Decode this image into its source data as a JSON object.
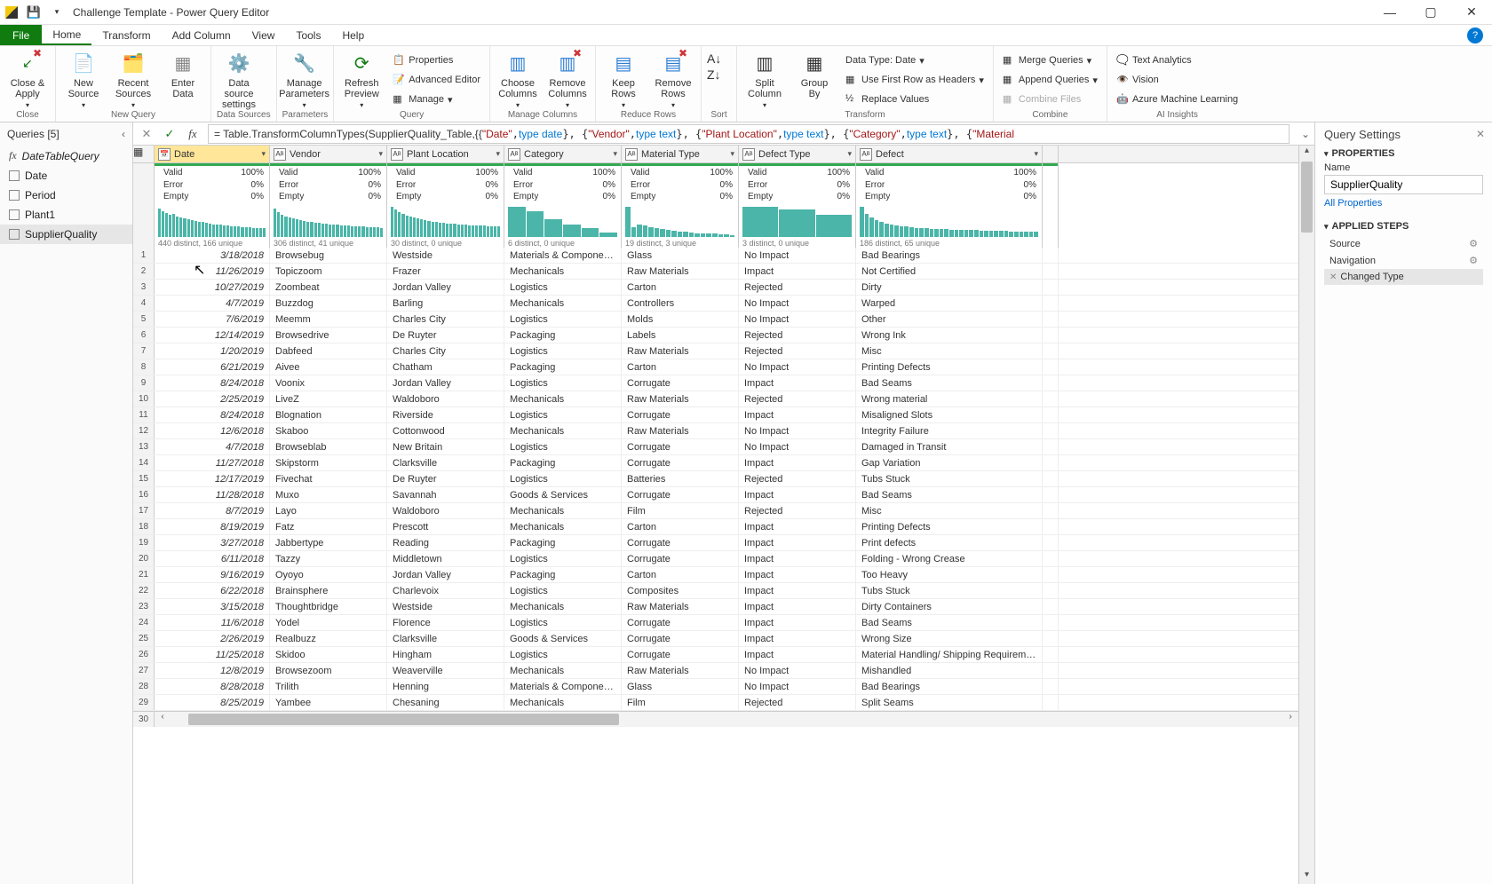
{
  "title": "Challenge Template - Power Query Editor",
  "menubar": {
    "file": "File",
    "tabs": [
      "Home",
      "Transform",
      "Add Column",
      "View",
      "Tools",
      "Help"
    ],
    "active": "Home"
  },
  "ribbon": {
    "close": {
      "label": "Close &\nApply",
      "group": "Close"
    },
    "new_query": {
      "new_source": "New\nSource",
      "recent": "Recent\nSources",
      "enter": "Enter\nData",
      "group": "New Query"
    },
    "data_sources": {
      "settings": "Data source\nsettings",
      "group": "Data Sources"
    },
    "parameters": {
      "manage": "Manage\nParameters",
      "group": "Parameters"
    },
    "query": {
      "refresh": "Refresh\nPreview",
      "properties": "Properties",
      "advanced": "Advanced Editor",
      "manage": "Manage",
      "group": "Query"
    },
    "manage_cols": {
      "choose": "Choose\nColumns",
      "remove": "Remove\nColumns",
      "group": "Manage Columns"
    },
    "reduce": {
      "keep": "Keep\nRows",
      "remove": "Remove\nRows",
      "group": "Reduce Rows"
    },
    "sort": {
      "group": "Sort"
    },
    "transform": {
      "split": "Split\nColumn",
      "group_by": "Group\nBy",
      "data_type": "Data Type: Date",
      "first_row": "Use First Row as Headers",
      "replace": "Replace Values",
      "group": "Transform"
    },
    "combine": {
      "merge": "Merge Queries",
      "append": "Append Queries",
      "combine_files": "Combine Files",
      "group": "Combine"
    },
    "ai": {
      "text": "Text Analytics",
      "vision": "Vision",
      "ml": "Azure Machine Learning",
      "group": "AI Insights"
    }
  },
  "queries_pane": {
    "title": "Queries [5]",
    "items": [
      {
        "name": "DateTableQuery",
        "type": "fx"
      },
      {
        "name": "Date",
        "type": "table"
      },
      {
        "name": "Period",
        "type": "table"
      },
      {
        "name": "Plant1",
        "type": "table"
      },
      {
        "name": "SupplierQuality",
        "type": "table",
        "selected": true
      }
    ]
  },
  "formula": {
    "prefix": "= Table.TransformColumnTypes(SupplierQuality_Table,{{",
    "seg_date_l": "\"Date\"",
    "seg_date_t": "type date",
    "seg_vendor_l": "\"Vendor\"",
    "seg_text": "type text",
    "seg_plant_l": "\"Plant Location\"",
    "seg_cat_l": "\"Category\"",
    "seg_mat_l": "\"Material"
  },
  "columns": [
    {
      "name": "Date",
      "cls": "col-w-date",
      "type": "📅",
      "selected": true,
      "stats": {
        "valid": "100%",
        "error": "0%",
        "empty": "0%"
      },
      "dist": "440 distinct, 166 unique",
      "hist": [
        90,
        80,
        75,
        70,
        72,
        65,
        60,
        58,
        55,
        52,
        50,
        48,
        46,
        44,
        42,
        40,
        40,
        38,
        36,
        35,
        34,
        33,
        32,
        31,
        30,
        30,
        29,
        28,
        28,
        27
      ]
    },
    {
      "name": "Vendor",
      "cls": "col-w-vendor",
      "type": "A",
      "stats": {
        "valid": "100%",
        "error": "0%",
        "empty": "0%"
      },
      "dist": "306 distinct, 41 unique",
      "hist": [
        88,
        78,
        70,
        65,
        62,
        58,
        55,
        52,
        50,
        48,
        46,
        45,
        44,
        42,
        41,
        40,
        39,
        38,
        37,
        36,
        35,
        34,
        33,
        32,
        32,
        31,
        31,
        30,
        30,
        29
      ]
    },
    {
      "name": "Plant Location",
      "cls": "col-w-plant",
      "type": "A",
      "stats": {
        "valid": "100%",
        "error": "0%",
        "empty": "0%"
      },
      "dist": "30 distinct, 0 unique",
      "hist": [
        95,
        85,
        78,
        72,
        68,
        64,
        60,
        57,
        55,
        52,
        50,
        48,
        47,
        45,
        44,
        43,
        42,
        41,
        40,
        39,
        38,
        37,
        36,
        36,
        35,
        35,
        34,
        34,
        33,
        33
      ]
    },
    {
      "name": "Category",
      "cls": "col-w-cat",
      "type": "A",
      "stats": {
        "valid": "100%",
        "error": "0%",
        "empty": "0%"
      },
      "dist": "6 distinct, 0 unique",
      "hist": [
        95,
        80,
        55,
        40,
        28,
        15
      ]
    },
    {
      "name": "Material Type",
      "cls": "col-w-mat",
      "type": "A",
      "stats": {
        "valid": "100%",
        "error": "0%",
        "empty": "0%"
      },
      "dist": "19 distinct, 3 unique",
      "hist": [
        95,
        30,
        40,
        35,
        30,
        28,
        25,
        22,
        20,
        18,
        16,
        14,
        12,
        12,
        10,
        10,
        8,
        8,
        6
      ]
    },
    {
      "name": "Defect Type",
      "cls": "col-w-dtype",
      "type": "A",
      "stats": {
        "valid": "100%",
        "error": "0%",
        "empty": "0%"
      },
      "dist": "3 distinct, 0 unique",
      "hist": [
        95,
        85,
        70
      ]
    },
    {
      "name": "Defect",
      "cls": "col-w-defect",
      "type": "A",
      "stats": {
        "valid": "100%",
        "error": "0%",
        "empty": "0%"
      },
      "dist": "186 distinct, 65 unique",
      "hist": [
        95,
        72,
        60,
        52,
        46,
        42,
        38,
        36,
        34,
        32,
        30,
        29,
        28,
        27,
        26,
        25,
        24,
        24,
        23,
        23,
        22,
        22,
        21,
        21,
        20,
        20,
        20,
        19,
        19,
        19,
        18,
        18,
        18,
        17,
        17,
        17
      ]
    }
  ],
  "stats_labels": {
    "valid": "Valid",
    "error": "Error",
    "empty": "Empty"
  },
  "rows": [
    {
      "n": 1,
      "date": "3/18/2018",
      "vendor": "Browsebug",
      "plant": "Westside",
      "cat": "Materials & Components",
      "mat": "Glass",
      "dtype": "No Impact",
      "defect": "Bad Bearings"
    },
    {
      "n": 2,
      "date": "11/26/2019",
      "vendor": "Topiczoom",
      "plant": "Frazer",
      "cat": "Mechanicals",
      "mat": "Raw Materials",
      "dtype": "Impact",
      "defect": "Not Certified"
    },
    {
      "n": 3,
      "date": "10/27/2019",
      "vendor": "Zoombeat",
      "plant": "Jordan Valley",
      "cat": "Logistics",
      "mat": "Carton",
      "dtype": "Rejected",
      "defect": "Dirty"
    },
    {
      "n": 4,
      "date": "4/7/2019",
      "vendor": "Buzzdog",
      "plant": "Barling",
      "cat": "Mechanicals",
      "mat": "Controllers",
      "dtype": "No Impact",
      "defect": "Warped"
    },
    {
      "n": 5,
      "date": "7/6/2019",
      "vendor": "Meemm",
      "plant": "Charles City",
      "cat": "Logistics",
      "mat": "Molds",
      "dtype": "No Impact",
      "defect": "Other"
    },
    {
      "n": 6,
      "date": "12/14/2019",
      "vendor": "Browsedrive",
      "plant": "De Ruyter",
      "cat": "Packaging",
      "mat": "Labels",
      "dtype": "Rejected",
      "defect": "Wrong Ink"
    },
    {
      "n": 7,
      "date": "1/20/2019",
      "vendor": "Dabfeed",
      "plant": "Charles City",
      "cat": "Logistics",
      "mat": "Raw Materials",
      "dtype": "Rejected",
      "defect": "Misc"
    },
    {
      "n": 8,
      "date": "6/21/2019",
      "vendor": "Aivee",
      "plant": "Chatham",
      "cat": "Packaging",
      "mat": "Carton",
      "dtype": "No Impact",
      "defect": "Printing Defects"
    },
    {
      "n": 9,
      "date": "8/24/2018",
      "vendor": "Voonix",
      "plant": "Jordan Valley",
      "cat": "Logistics",
      "mat": "Corrugate",
      "dtype": "Impact",
      "defect": "Bad Seams"
    },
    {
      "n": 10,
      "date": "2/25/2019",
      "vendor": "LiveZ",
      "plant": "Waldoboro",
      "cat": "Mechanicals",
      "mat": "Raw Materials",
      "dtype": "Rejected",
      "defect": "Wrong material"
    },
    {
      "n": 11,
      "date": "8/24/2018",
      "vendor": "Blognation",
      "plant": "Riverside",
      "cat": "Logistics",
      "mat": "Corrugate",
      "dtype": "Impact",
      "defect": "Misaligned Slots"
    },
    {
      "n": 12,
      "date": "12/6/2018",
      "vendor": "Skaboo",
      "plant": "Cottonwood",
      "cat": "Mechanicals",
      "mat": "Raw Materials",
      "dtype": "No Impact",
      "defect": "Integrity Failure"
    },
    {
      "n": 13,
      "date": "4/7/2018",
      "vendor": "Browseblab",
      "plant": "New Britain",
      "cat": "Logistics",
      "mat": "Corrugate",
      "dtype": "No Impact",
      "defect": "Damaged in Transit"
    },
    {
      "n": 14,
      "date": "11/27/2018",
      "vendor": "Skipstorm",
      "plant": "Clarksville",
      "cat": "Packaging",
      "mat": "Corrugate",
      "dtype": "Impact",
      "defect": "Gap Variation"
    },
    {
      "n": 15,
      "date": "12/17/2019",
      "vendor": "Fivechat",
      "plant": "De Ruyter",
      "cat": "Logistics",
      "mat": "Batteries",
      "dtype": "Rejected",
      "defect": "Tubs Stuck"
    },
    {
      "n": 16,
      "date": "11/28/2018",
      "vendor": "Muxo",
      "plant": "Savannah",
      "cat": "Goods & Services",
      "mat": "Corrugate",
      "dtype": "Impact",
      "defect": "Bad Seams"
    },
    {
      "n": 17,
      "date": "8/7/2019",
      "vendor": "Layo",
      "plant": "Waldoboro",
      "cat": "Mechanicals",
      "mat": "Film",
      "dtype": "Rejected",
      "defect": "Misc"
    },
    {
      "n": 18,
      "date": "8/19/2019",
      "vendor": "Fatz",
      "plant": "Prescott",
      "cat": "Mechanicals",
      "mat": "Carton",
      "dtype": "Impact",
      "defect": "Printing Defects"
    },
    {
      "n": 19,
      "date": "3/27/2018",
      "vendor": "Jabbertype",
      "plant": "Reading",
      "cat": "Packaging",
      "mat": "Corrugate",
      "dtype": "Impact",
      "defect": "Print defects"
    },
    {
      "n": 20,
      "date": "6/11/2018",
      "vendor": "Tazzy",
      "plant": "Middletown",
      "cat": "Logistics",
      "mat": "Corrugate",
      "dtype": "Impact",
      "defect": "Folding - Wrong Crease"
    },
    {
      "n": 21,
      "date": "9/16/2019",
      "vendor": "Oyoyo",
      "plant": "Jordan Valley",
      "cat": "Packaging",
      "mat": "Carton",
      "dtype": "Impact",
      "defect": "Too Heavy"
    },
    {
      "n": 22,
      "date": "6/22/2018",
      "vendor": "Brainsphere",
      "plant": "Charlevoix",
      "cat": "Logistics",
      "mat": "Composites",
      "dtype": "Impact",
      "defect": "Tubs Stuck"
    },
    {
      "n": 23,
      "date": "3/15/2018",
      "vendor": "Thoughtbridge",
      "plant": "Westside",
      "cat": "Mechanicals",
      "mat": "Raw Materials",
      "dtype": "Impact",
      "defect": "Dirty Containers"
    },
    {
      "n": 24,
      "date": "11/6/2018",
      "vendor": "Yodel",
      "plant": "Florence",
      "cat": "Logistics",
      "mat": "Corrugate",
      "dtype": "Impact",
      "defect": "Bad Seams"
    },
    {
      "n": 25,
      "date": "2/26/2019",
      "vendor": "Realbuzz",
      "plant": "Clarksville",
      "cat": "Goods & Services",
      "mat": "Corrugate",
      "dtype": "Impact",
      "defect": "Wrong Size"
    },
    {
      "n": 26,
      "date": "11/25/2018",
      "vendor": "Skidoo",
      "plant": "Hingham",
      "cat": "Logistics",
      "mat": "Corrugate",
      "dtype": "Impact",
      "defect": "Material Handling/ Shipping Requirements Error"
    },
    {
      "n": 27,
      "date": "12/8/2019",
      "vendor": "Browsezoom",
      "plant": "Weaverville",
      "cat": "Mechanicals",
      "mat": "Raw Materials",
      "dtype": "No Impact",
      "defect": "Mishandled"
    },
    {
      "n": 28,
      "date": "8/28/2018",
      "vendor": "Trilith",
      "plant": "Henning",
      "cat": "Materials & Components",
      "mat": "Glass",
      "dtype": "No Impact",
      "defect": "Bad Bearings"
    },
    {
      "n": 29,
      "date": "8/25/2019",
      "vendor": "Yambee",
      "plant": "Chesaning",
      "cat": "Mechanicals",
      "mat": "Film",
      "dtype": "Rejected",
      "defect": "Split Seams"
    }
  ],
  "extra_row_num": "30",
  "settings": {
    "title": "Query Settings",
    "properties": "PROPERTIES",
    "name_label": "Name",
    "name_value": "SupplierQuality",
    "all_props": "All Properties",
    "applied_steps": "APPLIED STEPS",
    "steps": [
      {
        "name": "Source",
        "gear": true
      },
      {
        "name": "Navigation",
        "gear": true
      },
      {
        "name": "Changed Type",
        "gear": false,
        "selected": true,
        "x": true
      }
    ]
  }
}
